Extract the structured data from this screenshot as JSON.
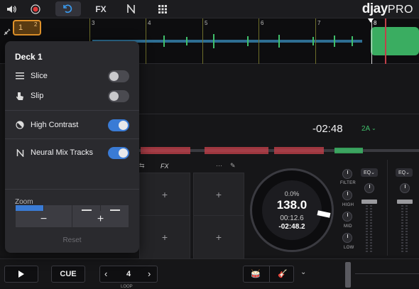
{
  "topbar": {
    "logo_main": "djay",
    "logo_sub": "PRO",
    "fx_label": "FX"
  },
  "overview": {
    "loop_number": "1",
    "loop_sub": "2",
    "beat_numbers": [
      "3",
      "4",
      "5",
      "6",
      "7",
      "8"
    ]
  },
  "popover": {
    "title": "Deck 1",
    "slice_label": "Slice",
    "slip_label": "Slip",
    "high_contrast_label": "High Contrast",
    "neural_mix_label": "Neural Mix Tracks",
    "zoom_label": "Zoom",
    "zoom_out": "−",
    "zoom_in": "+",
    "reset_label": "Reset",
    "toggles": {
      "slice": false,
      "slip": false,
      "high_contrast": true,
      "neural_mix": true
    },
    "segment_selected": 0
  },
  "deck": {
    "remaining_time": "-02:48",
    "key": "2A",
    "fx_tab": "FX",
    "pad_plus": "+"
  },
  "jog": {
    "pitch": "0.0%",
    "bpm": "138.0",
    "elapsed": "00:12.6",
    "remaining": "-02:48.2"
  },
  "mixer": {
    "filter_label": "FILTER",
    "high_label": "HIGH",
    "mid_label": "MID",
    "low_label": "LOW",
    "eq_label": "EQ",
    "eq2_label": "EQ"
  },
  "transport": {
    "cue_label": "CUE",
    "loop_value": "4",
    "loop_caption": "LOOP",
    "prev": "‹",
    "next": "›"
  },
  "colors": {
    "accent": "#3a7bd5",
    "loop_badge": "#e0922a",
    "wave_green": "#3fbf6a",
    "wave_red": "#c0404a"
  }
}
